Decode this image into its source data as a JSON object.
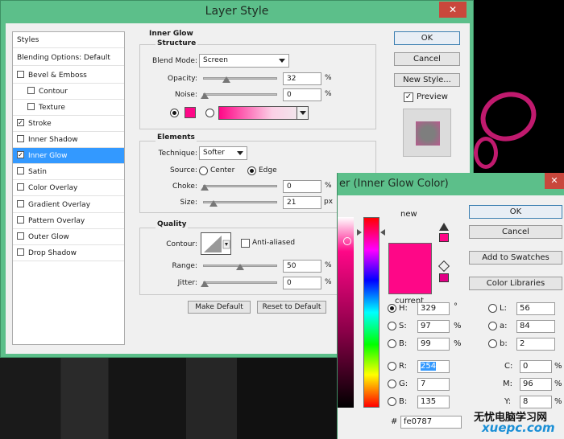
{
  "layer_style": {
    "title": "Layer Style",
    "close": "✕",
    "styles": [
      {
        "label": "Styles",
        "checkbox": false
      },
      {
        "label": "Blending Options: Default",
        "checkbox": false
      },
      {
        "label": "Bevel & Emboss",
        "checkbox": true,
        "checked": false
      },
      {
        "label": "Contour",
        "checkbox": true,
        "checked": false
      },
      {
        "label": "Texture",
        "checkbox": true,
        "checked": false
      },
      {
        "label": "Stroke",
        "checkbox": true,
        "checked": true
      },
      {
        "label": "Inner Shadow",
        "checkbox": true,
        "checked": false
      },
      {
        "label": "Inner Glow",
        "checkbox": true,
        "checked": true,
        "selected": true
      },
      {
        "label": "Satin",
        "checkbox": true,
        "checked": false
      },
      {
        "label": "Color Overlay",
        "checkbox": true,
        "checked": false
      },
      {
        "label": "Gradient Overlay",
        "checkbox": true,
        "checked": false
      },
      {
        "label": "Pattern Overlay",
        "checkbox": true,
        "checked": false
      },
      {
        "label": "Outer Glow",
        "checkbox": true,
        "checked": false
      },
      {
        "label": "Drop Shadow",
        "checkbox": true,
        "checked": false
      }
    ],
    "inner_glow": {
      "section_title": "Inner Glow",
      "structure_title": "Structure",
      "blend_mode_label": "Blend Mode:",
      "blend_mode_value": "Screen",
      "opacity_label": "Opacity:",
      "opacity_value": "32",
      "opacity_unit": "%",
      "noise_label": "Noise:",
      "noise_value": "0",
      "noise_unit": "%",
      "elements_title": "Elements",
      "technique_label": "Technique:",
      "technique_value": "Softer",
      "source_label": "Source:",
      "source_center": "Center",
      "source_edge": "Edge",
      "choke_label": "Choke:",
      "choke_value": "0",
      "choke_unit": "%",
      "size_label": "Size:",
      "size_value": "21",
      "size_unit": "px",
      "quality_title": "Quality",
      "contour_label": "Contour:",
      "anti_aliased_label": "Anti-aliased",
      "range_label": "Range:",
      "range_value": "50",
      "range_unit": "%",
      "jitter_label": "Jitter:",
      "jitter_value": "0",
      "jitter_unit": "%",
      "make_default": "Make Default",
      "reset_default": "Reset to Default",
      "glow_color": "#fe0787"
    },
    "buttons": {
      "ok": "OK",
      "cancel": "Cancel",
      "new_style": "New Style...",
      "preview": "Preview"
    }
  },
  "color_picker": {
    "title": "er (Inner Glow Color)",
    "close": "✕",
    "new_label": "new",
    "current_label": "current",
    "current_color": "#fe0787",
    "buttons": {
      "ok": "OK",
      "cancel": "Cancel",
      "add_to_swatches": "Add to Swatches",
      "color_libraries": "Color Libraries"
    },
    "hsb": [
      {
        "label": "H:",
        "value": "329",
        "unit": "°"
      },
      {
        "label": "S:",
        "value": "97",
        "unit": "%"
      },
      {
        "label": "B:",
        "value": "99",
        "unit": "%"
      }
    ],
    "lab": [
      {
        "label": "L:",
        "value": "56"
      },
      {
        "label": "a:",
        "value": "84"
      },
      {
        "label": "b:",
        "value": "2"
      }
    ],
    "rgb": [
      {
        "label": "R:",
        "value": "254"
      },
      {
        "label": "G:",
        "value": "7"
      },
      {
        "label": "B:",
        "value": "135"
      }
    ],
    "cmyk": [
      {
        "label": "C:",
        "value": "0",
        "unit": "%"
      },
      {
        "label": "M:",
        "value": "96",
        "unit": "%"
      },
      {
        "label": "Y:",
        "value": "8",
        "unit": "%"
      }
    ],
    "hex_label": "#",
    "hex_value": "fe0787"
  },
  "watermark": {
    "line1": "无忧电脑学习网",
    "line2": "xuepc.com"
  }
}
